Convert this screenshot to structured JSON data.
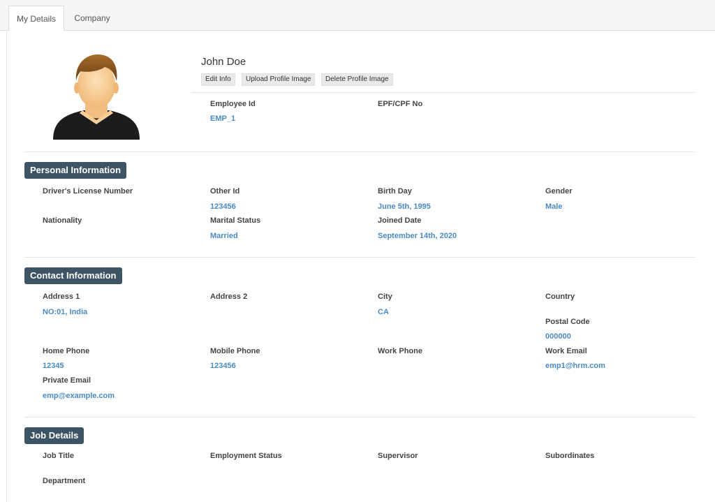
{
  "tabs": [
    {
      "label": "My Details"
    },
    {
      "label": "Company"
    }
  ],
  "profile": {
    "name": "John Doe",
    "buttons": {
      "edit": "Edit Info",
      "upload": "Upload Profile Image",
      "delete": "Delete Profile Image"
    },
    "employee_id_label": "Employee Id",
    "employee_id": "EMP_1",
    "epf_label": "EPF/CPF No",
    "epf": ""
  },
  "personal": {
    "title": "Personal Information",
    "drivers_license_label": "Driver's License Number",
    "drivers_license": "",
    "other_id_label": "Other Id",
    "other_id": "123456",
    "birth_day_label": "Birth Day",
    "birth_day": "June 5th, 1995",
    "gender_label": "Gender",
    "gender": "Male",
    "nationality_label": "Nationality",
    "nationality": "",
    "marital_status_label": "Marital Status",
    "marital_status": "Married",
    "joined_date_label": "Joined Date",
    "joined_date": "September 14th, 2020"
  },
  "contact": {
    "title": "Contact Information",
    "address1_label": "Address 1",
    "address1": "NO:01, India",
    "address2_label": "Address 2",
    "address2": "",
    "city_label": "City",
    "city": "CA",
    "country_label": "Country",
    "country": "",
    "postal_code_label": "Postal Code",
    "postal_code": "000000",
    "home_phone_label": "Home Phone",
    "home_phone": "12345",
    "mobile_phone_label": "Mobile Phone",
    "mobile_phone": "123456",
    "work_phone_label": "Work Phone",
    "work_phone": "",
    "work_email_label": "Work Email",
    "work_email": "emp1@hrm.com",
    "private_email_label": "Private Email",
    "private_email": "emp@example.com"
  },
  "job": {
    "title": "Job Details",
    "job_title_label": "Job Title",
    "employment_status_label": "Employment Status",
    "supervisor_label": "Supervisor",
    "subordinates_label": "Subordinates",
    "department_label": "Department"
  },
  "colors": {
    "section_bg": "#3d5464",
    "value_text": "#4a8ac4"
  }
}
